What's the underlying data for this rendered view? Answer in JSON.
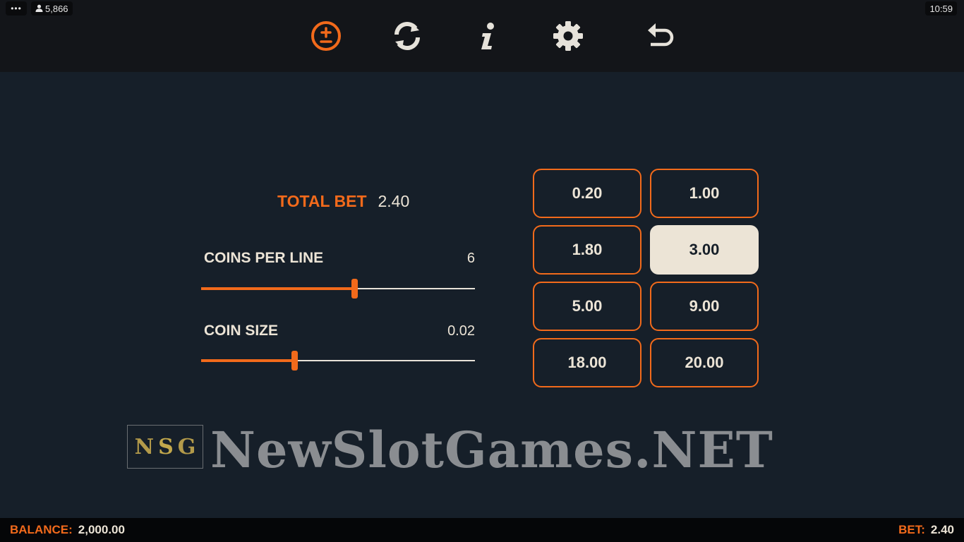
{
  "status": {
    "menu_glyph": "•••",
    "players": "5,866",
    "clock": "10:59"
  },
  "nav": [
    {
      "name": "bet-settings-icon",
      "active": true
    },
    {
      "name": "autoplay-icon",
      "active": false
    },
    {
      "name": "info-icon",
      "active": false
    },
    {
      "name": "settings-gear-icon",
      "active": false
    },
    {
      "name": "back-icon",
      "active": false
    }
  ],
  "bet_panel": {
    "total_bet_label": "TOTAL BET",
    "total_bet_value": "2.40",
    "coins_per_line": {
      "label": "COINS PER LINE",
      "value": "6",
      "fraction": 0.56
    },
    "coin_size": {
      "label": "COIN SIZE",
      "value": "0.02",
      "fraction": 0.34
    }
  },
  "bet_options": [
    "0.20",
    "1.00",
    "1.80",
    "3.00",
    "5.00",
    "9.00",
    "18.00",
    "20.00"
  ],
  "selected_bet": "3.00",
  "watermark": {
    "logo_letters": [
      "N",
      "S",
      "G"
    ],
    "text": "NewSlotGames.NET"
  },
  "footer": {
    "balance_label": "BALANCE:",
    "balance_value": "2,000.00",
    "bet_label": "BET:",
    "bet_value": "2.40"
  },
  "colors": {
    "accent": "#f26a1b",
    "text": "#ece4d6",
    "background": "#161f29"
  }
}
